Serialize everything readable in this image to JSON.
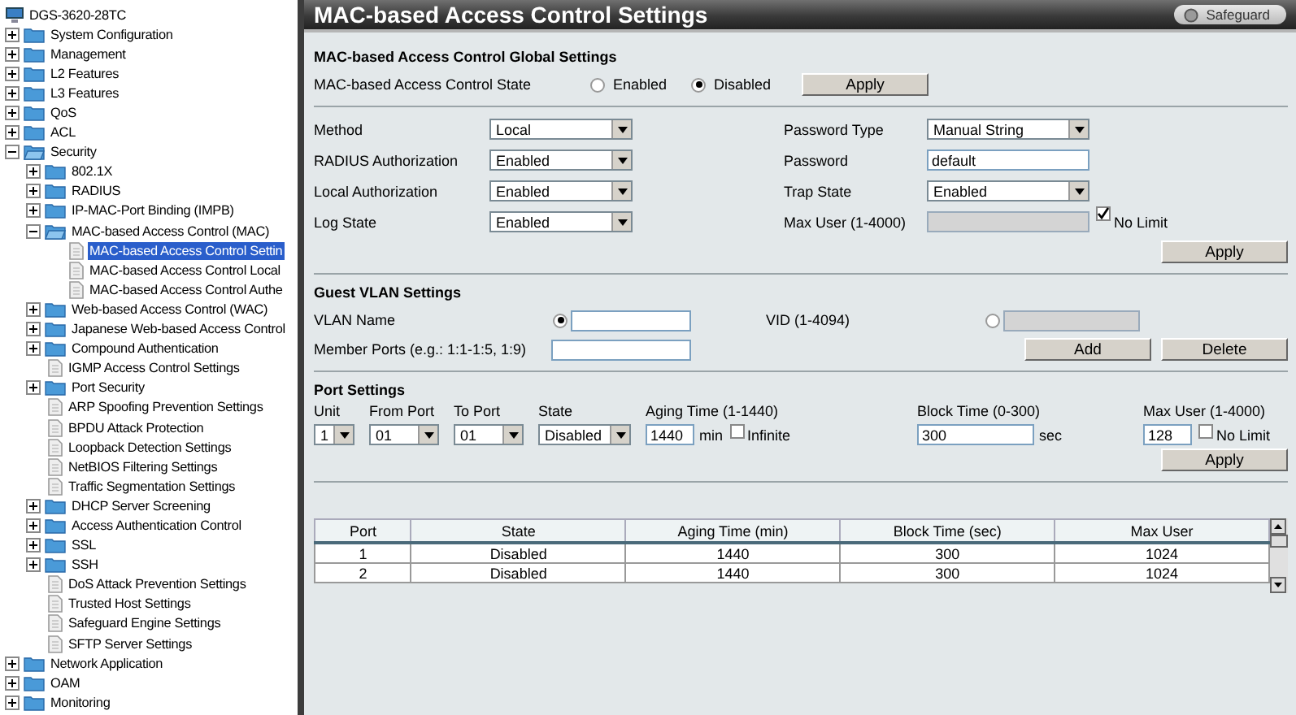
{
  "tree": {
    "label": "DGS-3620-28TC",
    "kind": "root",
    "children": [
      {
        "label": "System Configuration",
        "kind": "folder",
        "expanded": false,
        "selected": false
      },
      {
        "label": "Management",
        "kind": "folder",
        "expanded": false,
        "selected": false
      },
      {
        "label": "L2 Features",
        "kind": "folder",
        "expanded": false,
        "selected": false
      },
      {
        "label": "L3 Features",
        "kind": "folder",
        "expanded": false,
        "selected": false
      },
      {
        "label": "QoS",
        "kind": "folder",
        "expanded": false,
        "selected": false
      },
      {
        "label": "ACL",
        "kind": "folder",
        "expanded": false,
        "selected": false
      },
      {
        "label": "Security",
        "kind": "folder",
        "expanded": true,
        "selected": false,
        "children": [
          {
            "label": "802.1X",
            "kind": "folder",
            "expanded": false,
            "selected": false
          },
          {
            "label": "RADIUS",
            "kind": "folder",
            "expanded": false,
            "selected": false
          },
          {
            "label": "IP-MAC-Port Binding (IMPB)",
            "kind": "folder",
            "expanded": false,
            "selected": false
          },
          {
            "label": "MAC-based Access Control (MAC)",
            "kind": "folder",
            "expanded": true,
            "selected": false,
            "children": [
              {
                "label": "MAC-based Access Control Settin",
                "kind": "page",
                "selected": true
              },
              {
                "label": "MAC-based Access Control Local",
                "kind": "page",
                "selected": false
              },
              {
                "label": "MAC-based Access Control Authe",
                "kind": "page",
                "selected": false
              }
            ]
          },
          {
            "label": "Web-based Access Control (WAC)",
            "kind": "folder",
            "expanded": false,
            "selected": false
          },
          {
            "label": "Japanese Web-based Access Control",
            "kind": "folder",
            "expanded": false,
            "selected": false
          },
          {
            "label": "Compound Authentication",
            "kind": "folder",
            "expanded": false,
            "selected": false
          },
          {
            "label": "IGMP Access Control Settings",
            "kind": "page",
            "selected": false
          },
          {
            "label": "Port Security",
            "kind": "folder",
            "expanded": false,
            "selected": false
          },
          {
            "label": "ARP Spoofing Prevention Settings",
            "kind": "page",
            "selected": false
          },
          {
            "label": "BPDU Attack Protection",
            "kind": "page",
            "selected": false
          },
          {
            "label": "Loopback Detection Settings",
            "kind": "page",
            "selected": false
          },
          {
            "label": "NetBIOS Filtering Settings",
            "kind": "page",
            "selected": false
          },
          {
            "label": "Traffic Segmentation Settings",
            "kind": "page",
            "selected": false
          },
          {
            "label": "DHCP Server Screening",
            "kind": "folder",
            "expanded": false,
            "selected": false
          },
          {
            "label": "Access Authentication Control",
            "kind": "folder",
            "expanded": false,
            "selected": false
          },
          {
            "label": "SSL",
            "kind": "folder",
            "expanded": false,
            "selected": false
          },
          {
            "label": "SSH",
            "kind": "folder",
            "expanded": false,
            "selected": false
          },
          {
            "label": "DoS Attack Prevention Settings",
            "kind": "page",
            "selected": false
          },
          {
            "label": "Trusted Host Settings",
            "kind": "page",
            "selected": false
          },
          {
            "label": "Safeguard Engine Settings",
            "kind": "page",
            "selected": false
          },
          {
            "label": "SFTP Server Settings",
            "kind": "page",
            "selected": false
          }
        ]
      },
      {
        "label": "Network Application",
        "kind": "folder",
        "expanded": false,
        "selected": false
      },
      {
        "label": "OAM",
        "kind": "folder",
        "expanded": false,
        "selected": false
      },
      {
        "label": "Monitoring",
        "kind": "folder",
        "expanded": false,
        "selected": false
      }
    ]
  },
  "title": "MAC-based Access Control Settings",
  "safeguard": "Safeguard",
  "global": {
    "heading": "MAC-based Access Control Global Settings",
    "state_label": "MAC-based Access Control State",
    "options": [
      {
        "label": "Enabled",
        "selected": false
      },
      {
        "label": "Disabled",
        "selected": true
      }
    ],
    "apply": "Apply"
  },
  "settings": {
    "left": [
      {
        "label": "Method",
        "kind": "select",
        "value": "Local"
      },
      {
        "label": "RADIUS Authorization",
        "kind": "select",
        "value": "Enabled"
      },
      {
        "label": "Local Authorization",
        "kind": "select",
        "value": "Enabled"
      },
      {
        "label": "Log State",
        "kind": "select",
        "value": "Enabled"
      }
    ],
    "right": [
      {
        "label": "Password Type",
        "kind": "select",
        "value": "Manual String"
      },
      {
        "label": "Password",
        "kind": "text",
        "value": "default"
      },
      {
        "label": "Trap State",
        "kind": "select",
        "value": "Enabled"
      },
      {
        "label": "Max User (1-4000)",
        "kind": "limit",
        "disabled": true,
        "checkbox": {
          "label": "No Limit",
          "checked": true
        }
      }
    ],
    "apply": "Apply"
  },
  "guest_vlan": {
    "heading": "Guest VLAN Settings",
    "vlan_name": {
      "label": "VLAN Name",
      "selected": true
    },
    "vid": {
      "label": "VID (1-4094)",
      "selected": false
    },
    "member_ports": {
      "label": "Member Ports (e.g.: 1:1-1:5, 1:9)"
    },
    "buttons": [
      "Add",
      "Delete"
    ]
  },
  "port_settings": {
    "heading": "Port Settings",
    "selects": [
      {
        "label": "Unit",
        "value": "1"
      },
      {
        "label": "From Port",
        "value": "01"
      },
      {
        "label": "To Port",
        "value": "01"
      },
      {
        "label": "State",
        "value": "Disabled"
      }
    ],
    "aging": {
      "label": "Aging Time (1-1440)",
      "value": "1440",
      "unit": "min",
      "check": {
        "label": "Infinite",
        "checked": false
      }
    },
    "block": {
      "label": "Block Time (0-300)",
      "value": "300",
      "unit": "sec"
    },
    "max_user": {
      "label": "Max User (1-4000)",
      "value": "128",
      "check": {
        "label": "No Limit",
        "checked": false
      }
    },
    "apply": "Apply"
  },
  "table": {
    "columns": [
      "Port",
      "State",
      "Aging Time (min)",
      "Block Time (sec)",
      "Max User"
    ],
    "rows": [
      [
        "1",
        "Disabled",
        "1440",
        "300",
        "1024"
      ],
      [
        "2",
        "Disabled",
        "1440",
        "300",
        "1024"
      ]
    ]
  }
}
